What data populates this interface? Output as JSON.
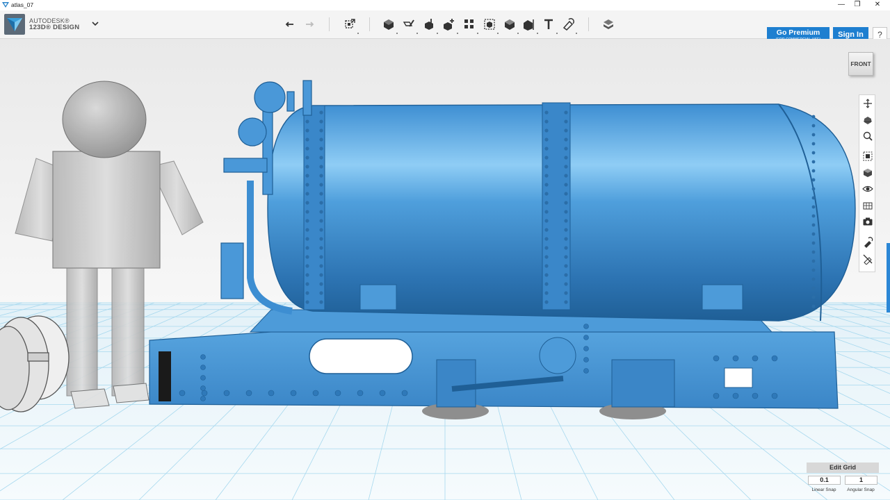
{
  "window": {
    "title": "atlas_07",
    "controls": {
      "minimize": "—",
      "maximize": "❐",
      "close": "✕"
    }
  },
  "app": {
    "brand_line1": "AUTODESK®",
    "brand_line2": "123D® DESIGN",
    "menu_icon": "chevron-down-icon"
  },
  "toolbar": {
    "tools": [
      "undo-icon",
      "redo-icon",
      "transform-icon",
      "primitives-icon",
      "sketch-icon",
      "construct-icon",
      "modify-icon",
      "pattern-icon",
      "grouping-icon",
      "combine-icon",
      "measure-icon",
      "text-icon",
      "snap-icon",
      "material-icon"
    ]
  },
  "account": {
    "premium_label": "Go Premium",
    "premium_sub": "(FOR COMMERCIAL USE)",
    "signin_label": "Sign In",
    "help_label": "?"
  },
  "viewcube": {
    "face_label": "FRONT"
  },
  "navbar": {
    "icons": [
      "pan-icon",
      "orbit-icon",
      "zoom-icon",
      "fit-icon",
      "view-perspective-icon",
      "visibility-icon",
      "material-display-icon",
      "screenshot-icon",
      "snap-toggle-icon",
      "hide-icon"
    ]
  },
  "grid": {
    "edit_label": "Edit Grid",
    "linear_snap_value": "0.1",
    "angular_snap_value": "1",
    "linear_snap_label": "Linear Snap",
    "angular_snap_label": "Angular Snap"
  },
  "colors": {
    "model_blue": "#3d8fd1",
    "model_dark": "#1f5f96",
    "accent_button": "#1e7fd0",
    "grid_line": "#9fd6ee"
  }
}
